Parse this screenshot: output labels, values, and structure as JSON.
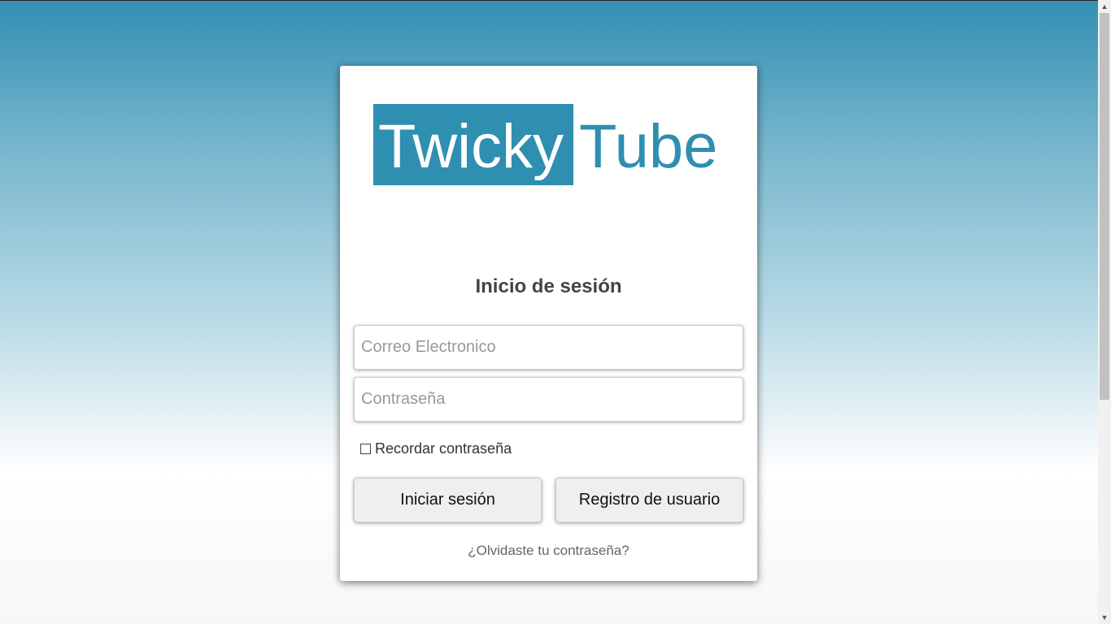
{
  "logo": {
    "part1": "Twicky",
    "part2": "Tube",
    "color": "#2e8fb0"
  },
  "form": {
    "title": "Inicio de sesión",
    "email_placeholder": "Correo Electronico",
    "email_value": "",
    "password_placeholder": "Contraseña",
    "password_value": "",
    "remember_label": "Recordar contraseña",
    "remember_checked": false,
    "login_button": "Iniciar sesión",
    "register_button": "Registro de usuario",
    "forgot_link": "¿Olvidaste tu contraseña?"
  },
  "scrollbar": {
    "up_icon": "▲",
    "down_icon": "▼"
  }
}
